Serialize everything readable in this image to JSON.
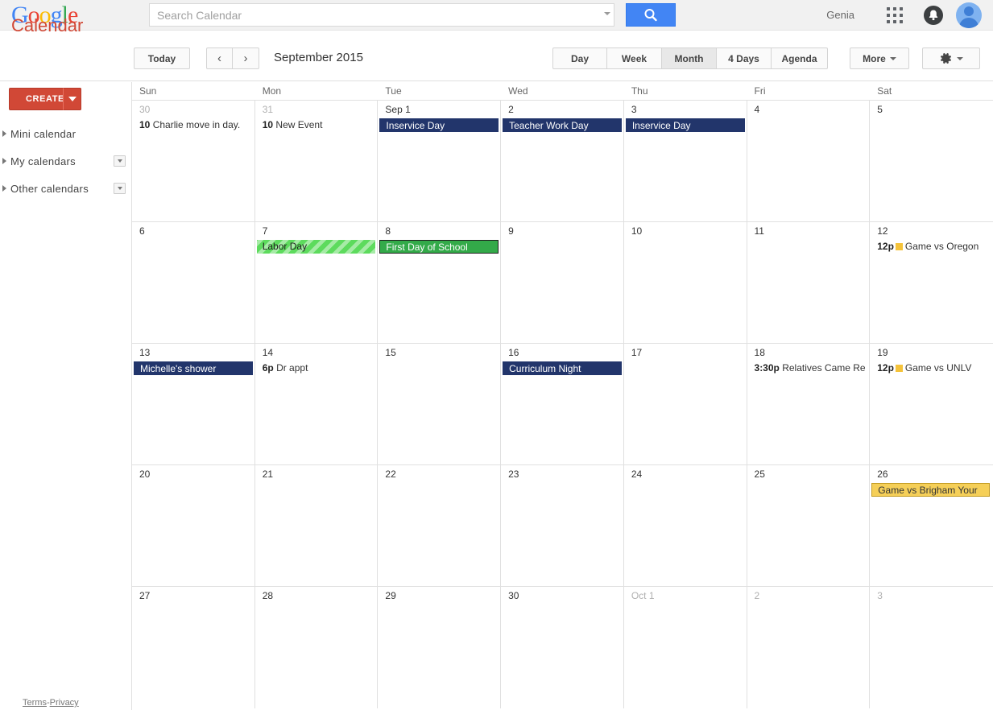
{
  "topbar": {
    "logo_text": "Google",
    "logo_letters": [
      "G",
      "o",
      "o",
      "g",
      "l",
      "e"
    ],
    "search": {
      "placeholder": "Search Calendar",
      "value": ""
    },
    "search_button_icon": "search-icon",
    "user_name": "Genia",
    "apps_icon": "apps-grid-icon",
    "notifications_icon": "bell-icon",
    "avatar_icon": "avatar-icon"
  },
  "subbar": {
    "app_title": "Calendar",
    "today_label": "Today",
    "prev_label": "‹",
    "next_label": "›",
    "month_label": "September 2015",
    "views": [
      {
        "label": "Day",
        "active": false
      },
      {
        "label": "Week",
        "active": false
      },
      {
        "label": "Month",
        "active": true
      },
      {
        "label": "4 Days",
        "active": false
      },
      {
        "label": "Agenda",
        "active": false
      }
    ],
    "more_label": "More",
    "gear_icon": "gear-icon"
  },
  "sidebar": {
    "create_label": "CREATE",
    "items": [
      {
        "label": "Mini calendar",
        "has_dropdown": false
      },
      {
        "label": "My calendars",
        "has_dropdown": true
      },
      {
        "label": "Other calendars",
        "has_dropdown": true
      }
    ],
    "footer": {
      "terms": "Terms",
      "separator": "-",
      "privacy": "Privacy"
    }
  },
  "calendar": {
    "day_headers": [
      "Sun",
      "Mon",
      "Tue",
      "Wed",
      "Thu",
      "Fri",
      "Sat"
    ],
    "weeks": [
      [
        {
          "num": "30",
          "other_month": true,
          "events": [
            {
              "style": "plain",
              "time": "10",
              "title": "Charlie move in day."
            }
          ]
        },
        {
          "num": "31",
          "other_month": true,
          "events": [
            {
              "style": "plain",
              "time": "10",
              "title": "New Event"
            }
          ]
        },
        {
          "num": "Sep 1",
          "other_month": false,
          "events": [
            {
              "style": "navy",
              "title": "Inservice Day"
            }
          ]
        },
        {
          "num": "2",
          "other_month": false,
          "events": [
            {
              "style": "navy",
              "title": "Teacher Work Day"
            }
          ]
        },
        {
          "num": "3",
          "other_month": false,
          "events": [
            {
              "style": "navy",
              "title": "Inservice Day"
            }
          ]
        },
        {
          "num": "4",
          "other_month": false,
          "events": []
        },
        {
          "num": "5",
          "other_month": false,
          "events": []
        }
      ],
      [
        {
          "num": "6",
          "other_month": false,
          "events": []
        },
        {
          "num": "7",
          "other_month": false,
          "events": [
            {
              "style": "stripe",
              "title": "Labor Day"
            }
          ]
        },
        {
          "num": "8",
          "other_month": false,
          "events": [
            {
              "style": "green",
              "title": "First Day of School"
            }
          ]
        },
        {
          "num": "9",
          "other_month": false,
          "events": []
        },
        {
          "num": "10",
          "other_month": false,
          "events": []
        },
        {
          "num": "11",
          "other_month": false,
          "events": []
        },
        {
          "num": "12",
          "other_month": false,
          "events": [
            {
              "style": "plain",
              "time": "12p",
              "chip_color": "#f5c33b",
              "title": "Game vs Oregon"
            }
          ]
        }
      ],
      [
        {
          "num": "13",
          "other_month": false,
          "events": [
            {
              "style": "navy",
              "title": "Michelle's shower"
            }
          ]
        },
        {
          "num": "14",
          "other_month": false,
          "events": [
            {
              "style": "plain",
              "time": "6p",
              "title": "Dr appt"
            }
          ]
        },
        {
          "num": "15",
          "other_month": false,
          "events": []
        },
        {
          "num": "16",
          "other_month": false,
          "events": [
            {
              "style": "navy",
              "title": "Curriculum Night"
            }
          ]
        },
        {
          "num": "17",
          "other_month": false,
          "events": []
        },
        {
          "num": "18",
          "other_month": false,
          "events": [
            {
              "style": "plain",
              "time": "3:30p",
              "title": "Relatives Came Re"
            }
          ]
        },
        {
          "num": "19",
          "other_month": false,
          "events": [
            {
              "style": "plain",
              "time": "12p",
              "chip_color": "#f5c33b",
              "title": "Game vs UNLV"
            }
          ]
        }
      ],
      [
        {
          "num": "20",
          "other_month": false,
          "events": []
        },
        {
          "num": "21",
          "other_month": false,
          "events": []
        },
        {
          "num": "22",
          "other_month": false,
          "events": []
        },
        {
          "num": "23",
          "other_month": false,
          "events": []
        },
        {
          "num": "24",
          "other_month": false,
          "events": []
        },
        {
          "num": "25",
          "other_month": false,
          "events": []
        },
        {
          "num": "26",
          "other_month": false,
          "events": [
            {
              "style": "gold",
              "title": "Game vs Brigham Your"
            }
          ]
        }
      ],
      [
        {
          "num": "27",
          "other_month": false,
          "events": []
        },
        {
          "num": "28",
          "other_month": false,
          "events": []
        },
        {
          "num": "29",
          "other_month": false,
          "events": []
        },
        {
          "num": "30",
          "other_month": false,
          "events": []
        },
        {
          "num": "Oct 1",
          "other_month": true,
          "events": []
        },
        {
          "num": "2",
          "other_month": true,
          "events": []
        },
        {
          "num": "3",
          "other_month": true,
          "events": []
        }
      ]
    ]
  },
  "colors": {
    "brand_red": "#d14836",
    "accent_blue": "#4285f4",
    "event_navy": "#22356b",
    "event_green": "#33aa49",
    "event_stripe_green": "#5ddb5d",
    "event_gold": "#f5cf58",
    "chip_yellow": "#f5c33b"
  }
}
